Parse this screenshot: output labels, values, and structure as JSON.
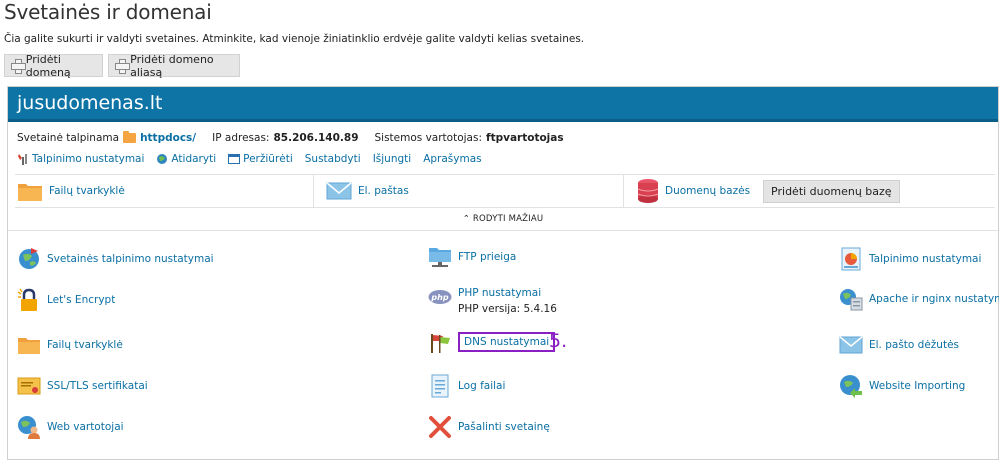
{
  "page": {
    "title": "Svetainės ir domenai",
    "description": "Čia galite sukurti ir valdyti svetaines. Atminkite, kad vienoje žiniatinklio erdvėje galite valdyti kelias svetaines."
  },
  "top_buttons": {
    "add_domain": "Pridėti domeną",
    "add_alias": "Pridėti domeno aliasą"
  },
  "domain": {
    "name": "jusudomenas.lt",
    "hosting_label": "Svetainė talpinama",
    "hosting_path": "httpdocs/",
    "ip_label": "IP adresas:",
    "ip_value": "85.206.140.89",
    "user_label": "Sistemos vartotojas:",
    "user_value": "ftpvartotojas"
  },
  "actions": {
    "hosting_settings": "Talpinimo nustatymai",
    "open": "Atidaryti",
    "preview": "Peržiūrėti",
    "suspend": "Sustabdyti",
    "disable": "Išjungti",
    "description": "Aprašymas"
  },
  "quick": {
    "file_manager": "Failų tvarkyklė",
    "mail": "El. paštas",
    "databases": "Duomenų bazės",
    "add_database": "Pridėti duomenų bazę"
  },
  "toggle": {
    "label": "RODYTI MAŽIAU"
  },
  "tools": {
    "site_hosting_settings": "Svetainės talpinimo nustatymai",
    "ftp_access": "FTP prieiga",
    "hosting_settings_right": "Talpinimo nustatymai",
    "lets_encrypt": "Let's Encrypt",
    "php_settings": "PHP nustatymai",
    "php_version": "PHP versija: 5.4.16",
    "apache_nginx": "Apache ir nginx nustatymai",
    "file_manager": "Failų tvarkyklė",
    "dns_settings": "DNS nustatymai",
    "mailboxes": "El. pašto dėžutės",
    "ssl_certs": "SSL/TLS sertifikatai",
    "log_files": "Log failai",
    "website_importing": "Website Importing",
    "web_users": "Web vartotojai",
    "remove_site": "Pašalinti svetainę"
  },
  "annotation": {
    "step": "5."
  },
  "colors": {
    "header_blue": "#0e74a6",
    "link_blue": "#0a6fa3",
    "highlight_purple": "#8a1fc4"
  }
}
